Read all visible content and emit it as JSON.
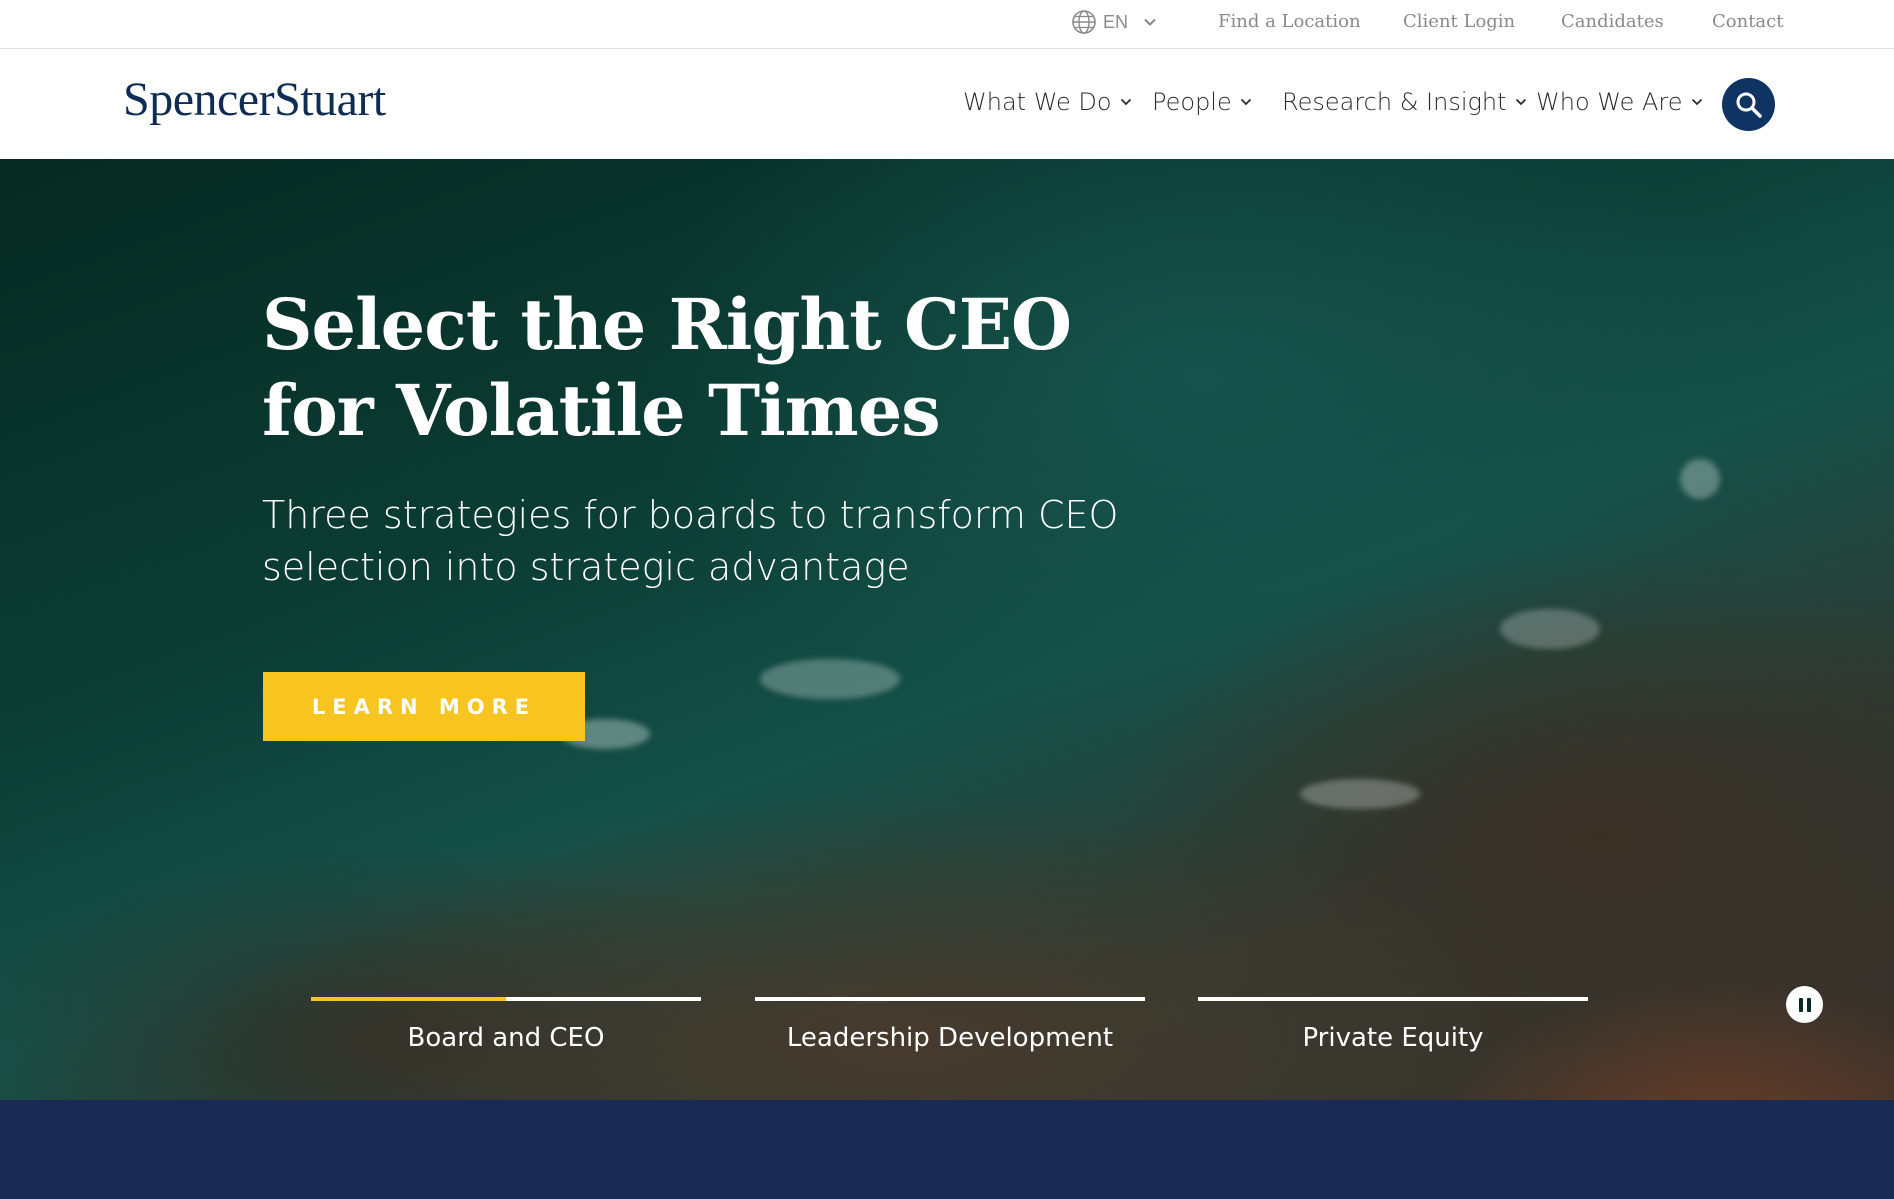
{
  "utility_bar": {
    "language": "EN",
    "links": [
      "Find a Location",
      "Client Login",
      "Candidates",
      "Contact"
    ]
  },
  "brand": {
    "logo_text": "SpencerStuart",
    "color": "#0f2d54"
  },
  "nav": {
    "items": [
      "What We Do",
      "People",
      "Research & Insight",
      "Who We Are"
    ],
    "search_icon": "search-icon"
  },
  "hero": {
    "title": "Select the Right CEO for Volatile Times",
    "subtitle": "Three strategies for boards to transform CEO selection into strategic advantage",
    "cta_label": "LEARN MORE",
    "cta_color": "#f8c41f",
    "slides": [
      {
        "label": "Board and CEO",
        "progress": 0.5
      },
      {
        "label": "Leadership Development",
        "progress": 0
      },
      {
        "label": "Private Equity",
        "progress": 0
      }
    ],
    "pause_icon": "pause-icon"
  },
  "bottom_band": {
    "color": "#192b52"
  }
}
